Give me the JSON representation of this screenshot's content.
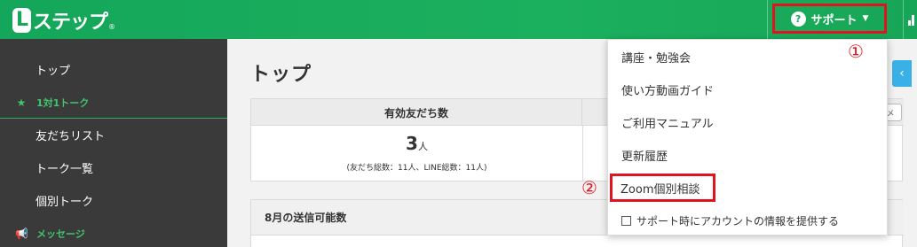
{
  "header": {
    "logo_box": "L",
    "logo_rest": "ステップ",
    "logo_reg": "®",
    "support_label": "サポート",
    "support_icon": "question-circle-icon",
    "chevron": "⌄"
  },
  "sidebar": {
    "items": [
      {
        "label": "トップ"
      },
      {
        "label": "1対1トーク",
        "section": true,
        "icon": "star-icon"
      },
      {
        "label": "友だちリスト"
      },
      {
        "label": "トーク一覧"
      },
      {
        "label": "個別トーク"
      },
      {
        "label": "メッセージ",
        "section": true,
        "icon": "megaphone-icon"
      }
    ]
  },
  "main": {
    "title": "トップ",
    "stats": {
      "header_label": "有効友だち数",
      "value": "3",
      "unit": "人",
      "sub": "(友だち総数：11人、LINE総数：11人)"
    },
    "mini_button": "メ",
    "send_box_title": "8月の送信可能数"
  },
  "dropdown": {
    "items": [
      "講座・勉強会",
      "使い方動画ガイド",
      "ご利用マニュアル",
      "更新履歴",
      "Zoom個別相談"
    ],
    "checkbox_label": "サポート時にアカウントの情報を提供する"
  },
  "markers": {
    "one": "①",
    "two": "②"
  },
  "colors": {
    "brand_green": "#15a85b",
    "highlight_red": "#e0141e",
    "sidebar_bg": "#3a3a3a"
  }
}
